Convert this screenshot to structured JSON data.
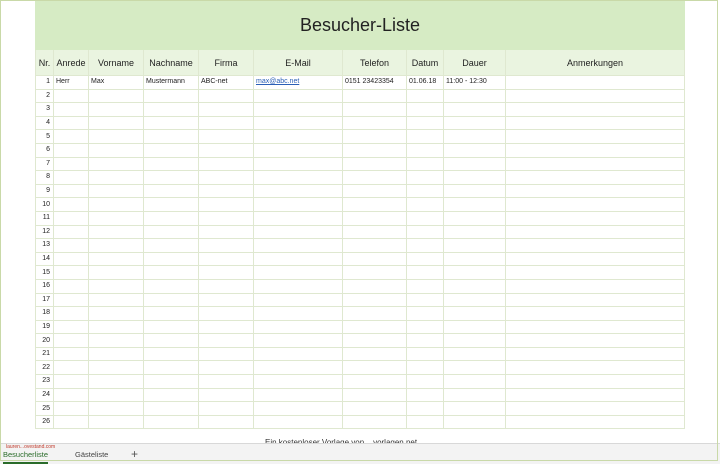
{
  "sheet": {
    "title": "Besucher-Liste",
    "columns": [
      "Nr.",
      "Anrede",
      "Vorname",
      "Nachname",
      "Firma",
      "E-Mail",
      "Telefon",
      "Datum",
      "Dauer",
      "Anmerkungen"
    ],
    "rows": [
      [
        "1",
        "Herr",
        "Max",
        "Mustermann",
        "ABC-net",
        "max@abc.net",
        "0151 23423354",
        "01.06.18",
        "11:00 - 12:30",
        ""
      ],
      [
        "2",
        "",
        "",
        "",
        "",
        "",
        "",
        "",
        "",
        ""
      ],
      [
        "3",
        "",
        "",
        "",
        "",
        "",
        "",
        "",
        "",
        ""
      ],
      [
        "4",
        "",
        "",
        "",
        "",
        "",
        "",
        "",
        "",
        ""
      ],
      [
        "5",
        "",
        "",
        "",
        "",
        "",
        "",
        "",
        "",
        ""
      ],
      [
        "6",
        "",
        "",
        "",
        "",
        "",
        "",
        "",
        "",
        ""
      ],
      [
        "7",
        "",
        "",
        "",
        "",
        "",
        "",
        "",
        "",
        ""
      ],
      [
        "8",
        "",
        "",
        "",
        "",
        "",
        "",
        "",
        "",
        ""
      ],
      [
        "9",
        "",
        "",
        "",
        "",
        "",
        "",
        "",
        "",
        ""
      ],
      [
        "10",
        "",
        "",
        "",
        "",
        "",
        "",
        "",
        "",
        ""
      ],
      [
        "11",
        "",
        "",
        "",
        "",
        "",
        "",
        "",
        "",
        ""
      ],
      [
        "12",
        "",
        "",
        "",
        "",
        "",
        "",
        "",
        "",
        ""
      ],
      [
        "13",
        "",
        "",
        "",
        "",
        "",
        "",
        "",
        "",
        ""
      ],
      [
        "14",
        "",
        "",
        "",
        "",
        "",
        "",
        "",
        "",
        ""
      ],
      [
        "15",
        "",
        "",
        "",
        "",
        "",
        "",
        "",
        "",
        ""
      ],
      [
        "16",
        "",
        "",
        "",
        "",
        "",
        "",
        "",
        "",
        ""
      ],
      [
        "17",
        "",
        "",
        "",
        "",
        "",
        "",
        "",
        "",
        ""
      ],
      [
        "18",
        "",
        "",
        "",
        "",
        "",
        "",
        "",
        "",
        ""
      ],
      [
        "19",
        "",
        "",
        "",
        "",
        "",
        "",
        "",
        "",
        ""
      ],
      [
        "20",
        "",
        "",
        "",
        "",
        "",
        "",
        "",
        "",
        ""
      ],
      [
        "21",
        "",
        "",
        "",
        "",
        "",
        "",
        "",
        "",
        ""
      ],
      [
        "22",
        "",
        "",
        "",
        "",
        "",
        "",
        "",
        "",
        ""
      ],
      [
        "23",
        "",
        "",
        "",
        "",
        "",
        "",
        "",
        "",
        ""
      ],
      [
        "24",
        "",
        "",
        "",
        "",
        "",
        "",
        "",
        "",
        ""
      ],
      [
        "25",
        "",
        "",
        "",
        "",
        "",
        "",
        "",
        "",
        ""
      ],
      [
        "26",
        "",
        "",
        "",
        "",
        "",
        "",
        "",
        "",
        ""
      ]
    ],
    "link_color": "#2b5fb6",
    "header_color": "#d6ebc4"
  },
  "tabs": [
    {
      "label": "Besucherliste",
      "active": true
    },
    {
      "label": "Gästeliste",
      "active": false
    }
  ],
  "add_tab_label": "+",
  "footer_note": "Ein kostenloser Vorlage von ...vorlagen.net",
  "watermark": "lauren...ovestand.com"
}
